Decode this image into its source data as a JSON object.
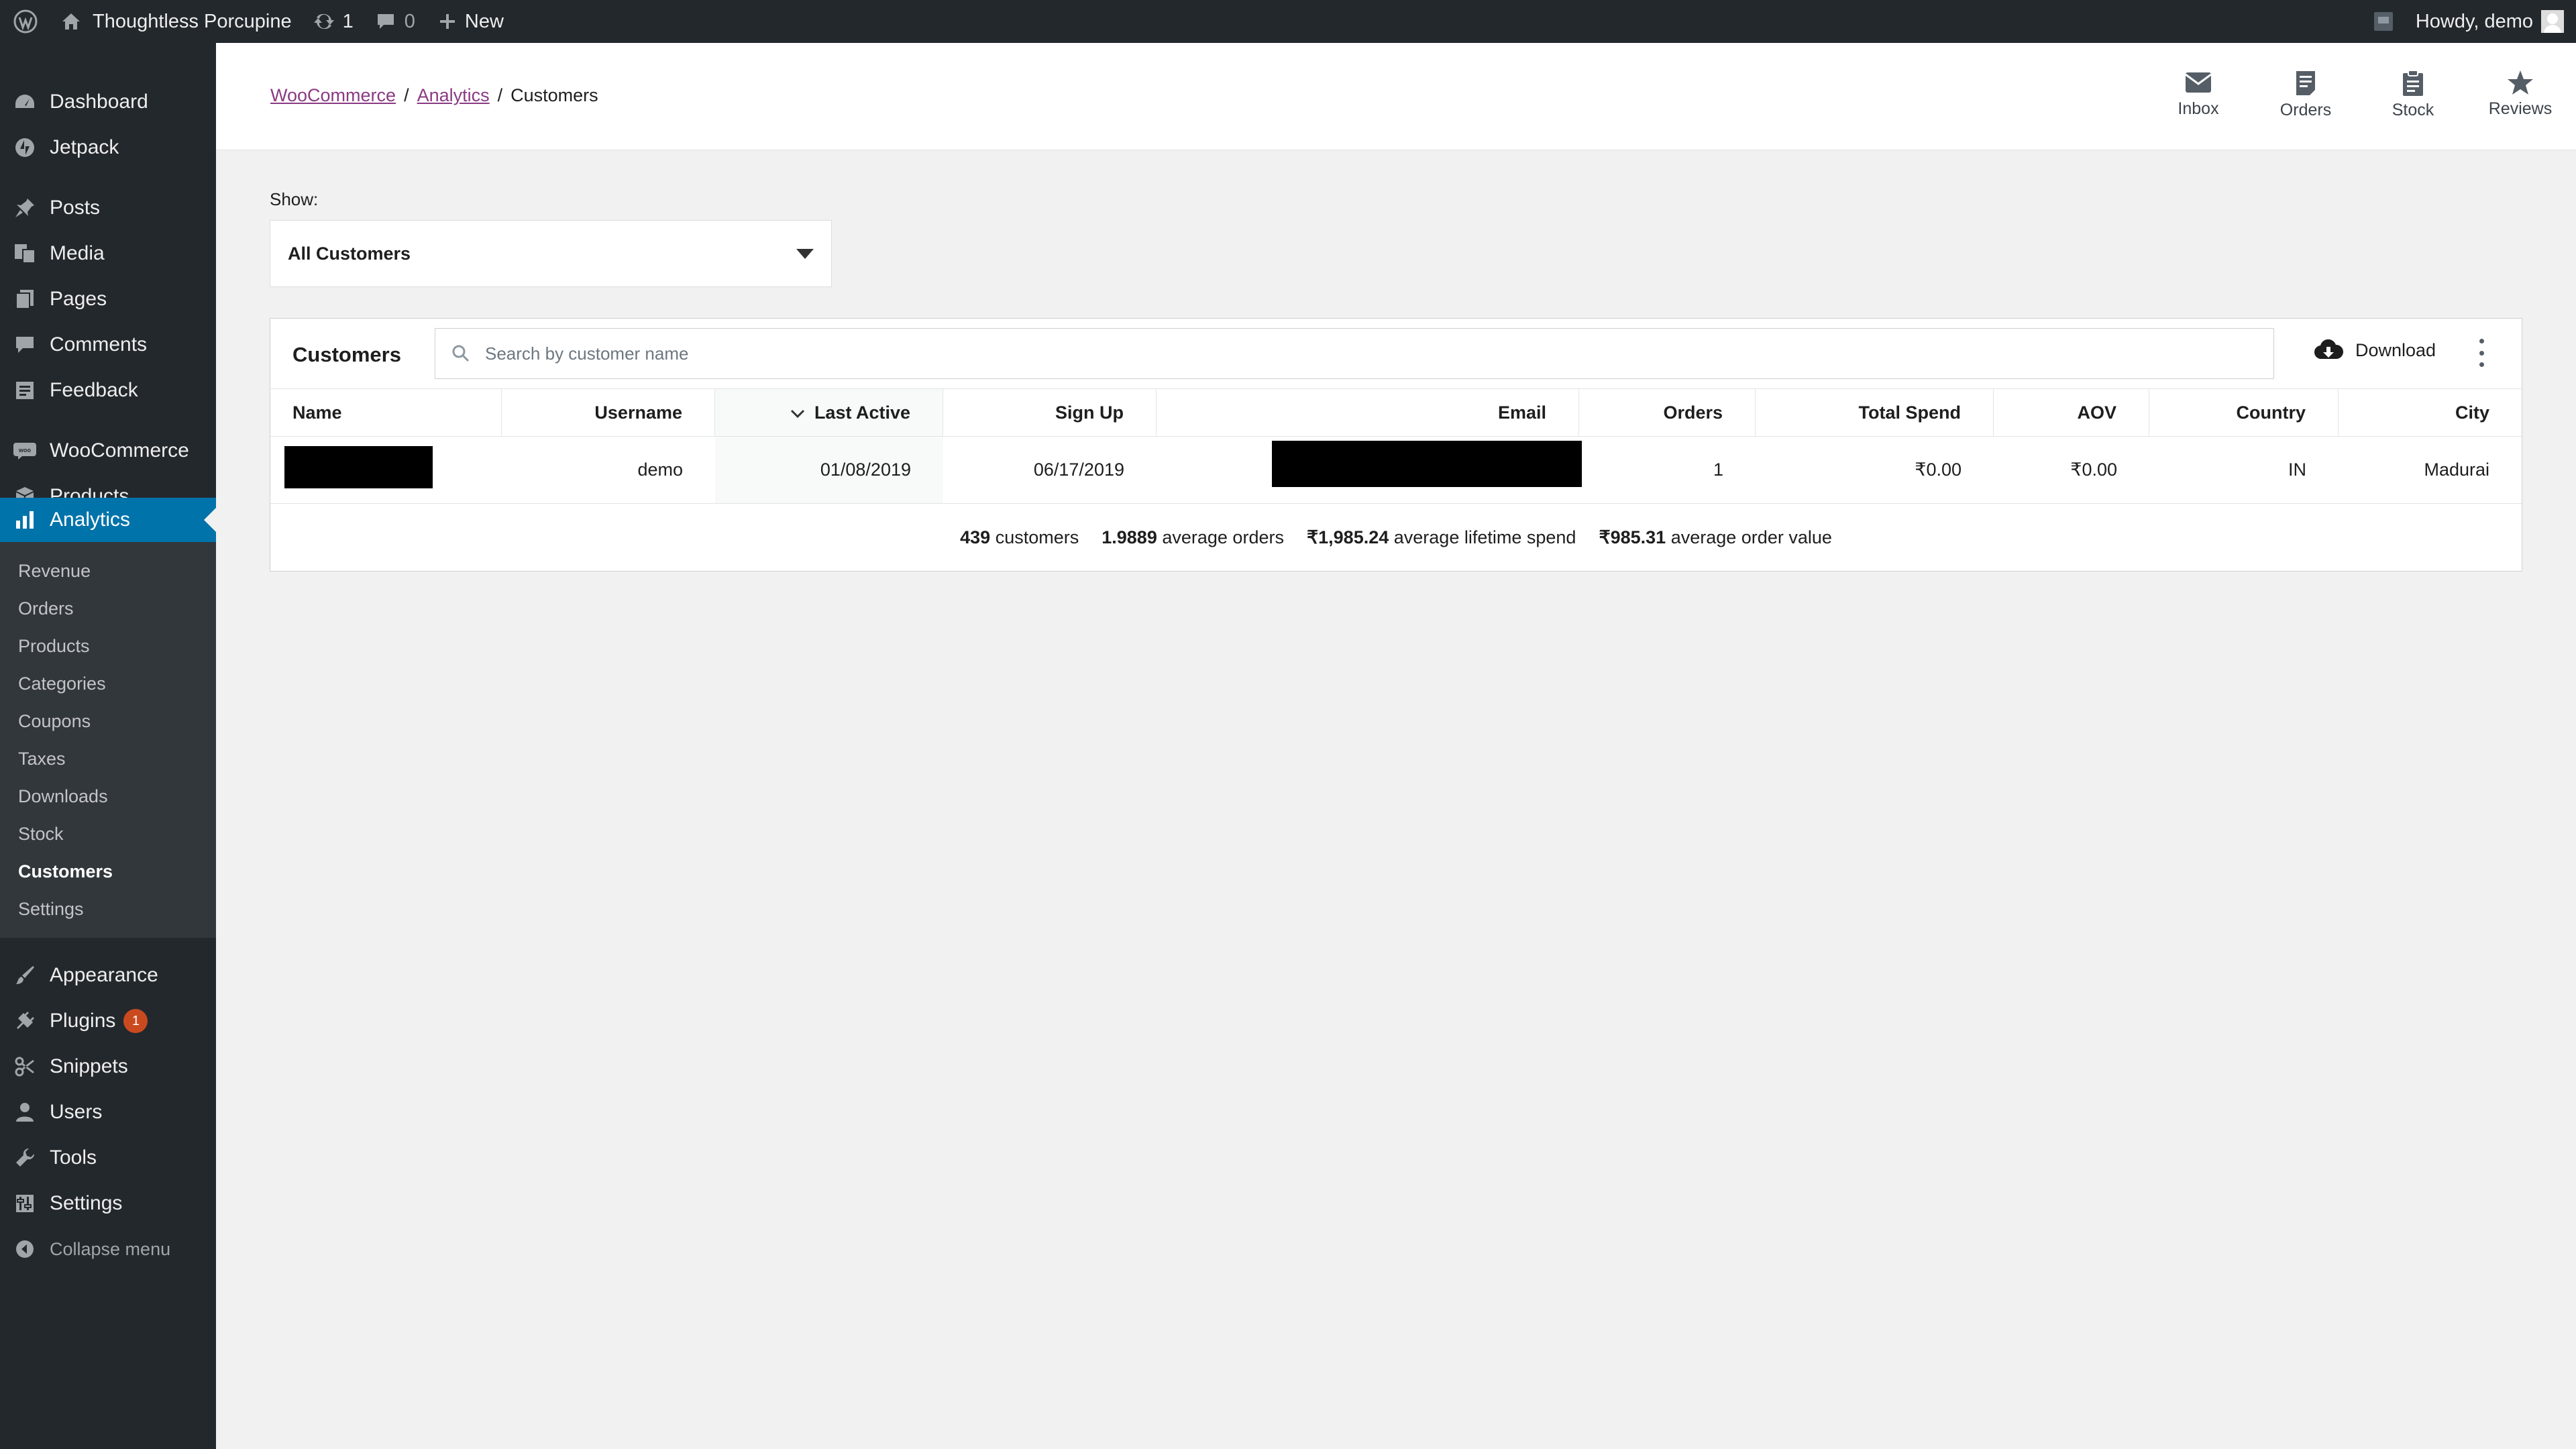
{
  "admin_bar": {
    "site_name": "Thoughtless Porcupine",
    "updates_count": "1",
    "comments_count": "0",
    "new_label": "New",
    "greeting": "Howdy, demo"
  },
  "sidebar": {
    "items": [
      {
        "label": "Dashboard",
        "icon": "dashboard-icon"
      },
      {
        "label": "Jetpack",
        "icon": "jetpack-icon"
      },
      {
        "label": "Posts",
        "icon": "pin-icon"
      },
      {
        "label": "Media",
        "icon": "media-icon"
      },
      {
        "label": "Pages",
        "icon": "pages-icon"
      },
      {
        "label": "Comments",
        "icon": "comment-icon"
      },
      {
        "label": "Feedback",
        "icon": "feedback-icon"
      },
      {
        "label": "WooCommerce",
        "icon": "woo-icon"
      },
      {
        "label": "Products",
        "icon": "box-icon"
      },
      {
        "label": "Analytics",
        "icon": "bar-chart-icon"
      },
      {
        "label": "Appearance",
        "icon": "brush-icon"
      },
      {
        "label": "Plugins",
        "icon": "plug-icon",
        "badge": "1"
      },
      {
        "label": "Snippets",
        "icon": "scissors-icon"
      },
      {
        "label": "Users",
        "icon": "user-icon"
      },
      {
        "label": "Tools",
        "icon": "wrench-icon"
      },
      {
        "label": "Settings",
        "icon": "settings-icon"
      },
      {
        "label": "Collapse menu",
        "icon": "collapse-icon"
      }
    ],
    "submenu": [
      "Revenue",
      "Orders",
      "Products",
      "Categories",
      "Coupons",
      "Taxes",
      "Downloads",
      "Stock",
      "Customers",
      "Settings"
    ],
    "submenu_current": "Customers"
  },
  "header": {
    "breadcrumb": [
      "WooCommerce",
      "Analytics",
      "Customers"
    ],
    "buttons": [
      "Inbox",
      "Orders",
      "Stock",
      "Reviews"
    ]
  },
  "filter": {
    "label": "Show:",
    "selected": "All Customers"
  },
  "table": {
    "title": "Customers",
    "search_placeholder": "Search by customer name",
    "download_label": "Download",
    "columns": [
      "Name",
      "Username",
      "Last Active",
      "Sign Up",
      "Email",
      "Orders",
      "Total Spend",
      "AOV",
      "Country",
      "City"
    ],
    "sorted_column": "Last Active",
    "rows": [
      {
        "name": "",
        "username": "demo",
        "last_active": "01/08/2019",
        "sign_up": "06/17/2019",
        "email": "",
        "orders": "1",
        "total_spend": "₹0.00",
        "aov": "₹0.00",
        "country": "IN",
        "city": "Madurai"
      }
    ],
    "summary": [
      {
        "value": "439",
        "label": "customers"
      },
      {
        "value": "1.9889",
        "label": "average orders"
      },
      {
        "value": "₹1,985.24",
        "label": "average lifetime spend"
      },
      {
        "value": "₹985.31",
        "label": "average order value"
      }
    ]
  }
}
